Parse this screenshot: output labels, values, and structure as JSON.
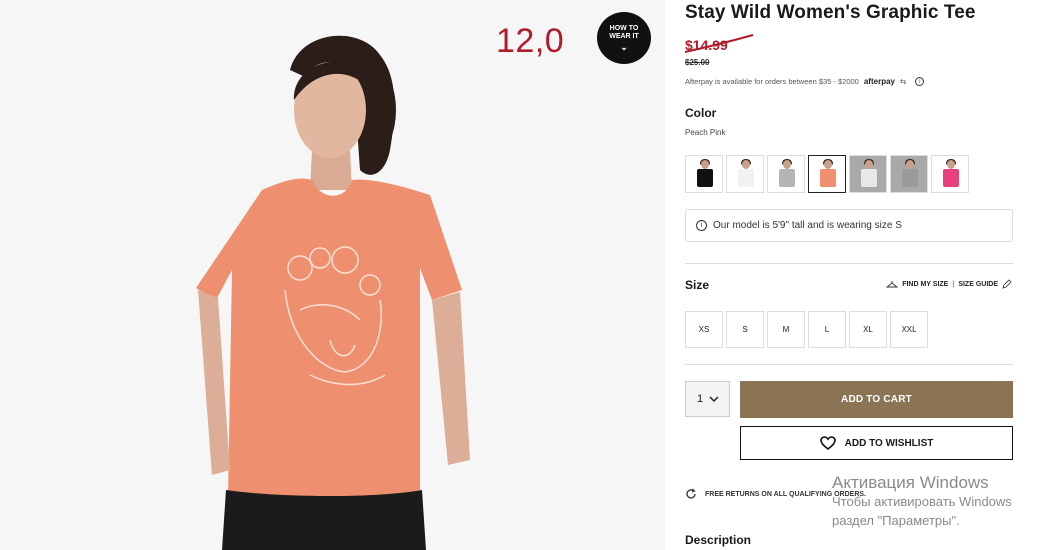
{
  "overlay": {
    "price_badge": "12,0"
  },
  "how_to_wear": {
    "line1": "HOW TO",
    "line2": "WEAR IT",
    "chevron": "⌄"
  },
  "product": {
    "title": "Stay Wild Women's Graphic Tee",
    "sale_price": "$14.99",
    "original_price": "$25.00",
    "afterpay_text": "Afterpay is available for orders between $35 - $2000",
    "afterpay_logo": "afterpay",
    "afterpay_icon": "⇆"
  },
  "color": {
    "label": "Color",
    "selected": "Peach Pink",
    "swatches": [
      {
        "name": "Black",
        "color": "#111111"
      },
      {
        "name": "White",
        "color": "#f2f2f2"
      },
      {
        "name": "Gray",
        "color": "#b5b5b5"
      },
      {
        "name": "Peach Pink",
        "color": "#ee8f6f"
      },
      {
        "name": "White Alt",
        "color": "#e8e8e8"
      },
      {
        "name": "Heather Gray",
        "color": "#9a9a9a"
      },
      {
        "name": "Pink",
        "color": "#e8417d"
      }
    ]
  },
  "model_info": {
    "icon": "i",
    "text": "Our model is 5'9\" tall and is wearing size S"
  },
  "size": {
    "label": "Size",
    "find_my_size": "FIND MY SIZE",
    "separator": "|",
    "size_guide": "SIZE GUIDE",
    "options": [
      "XS",
      "S",
      "M",
      "L",
      "XL",
      "XXL"
    ]
  },
  "cart": {
    "quantity": "1",
    "add_to_cart": "ADD TO CART",
    "add_to_wishlist": "ADD TO WISHLIST"
  },
  "returns": {
    "text": "FREE RETURNS ON ALL QUALIFYING ORDERS."
  },
  "description": {
    "label": "Description"
  },
  "windows_activation": {
    "line1": "Активация Windows",
    "line2": "Чтобы активировать Windows",
    "line3": "раздел \"Параметры\"."
  }
}
